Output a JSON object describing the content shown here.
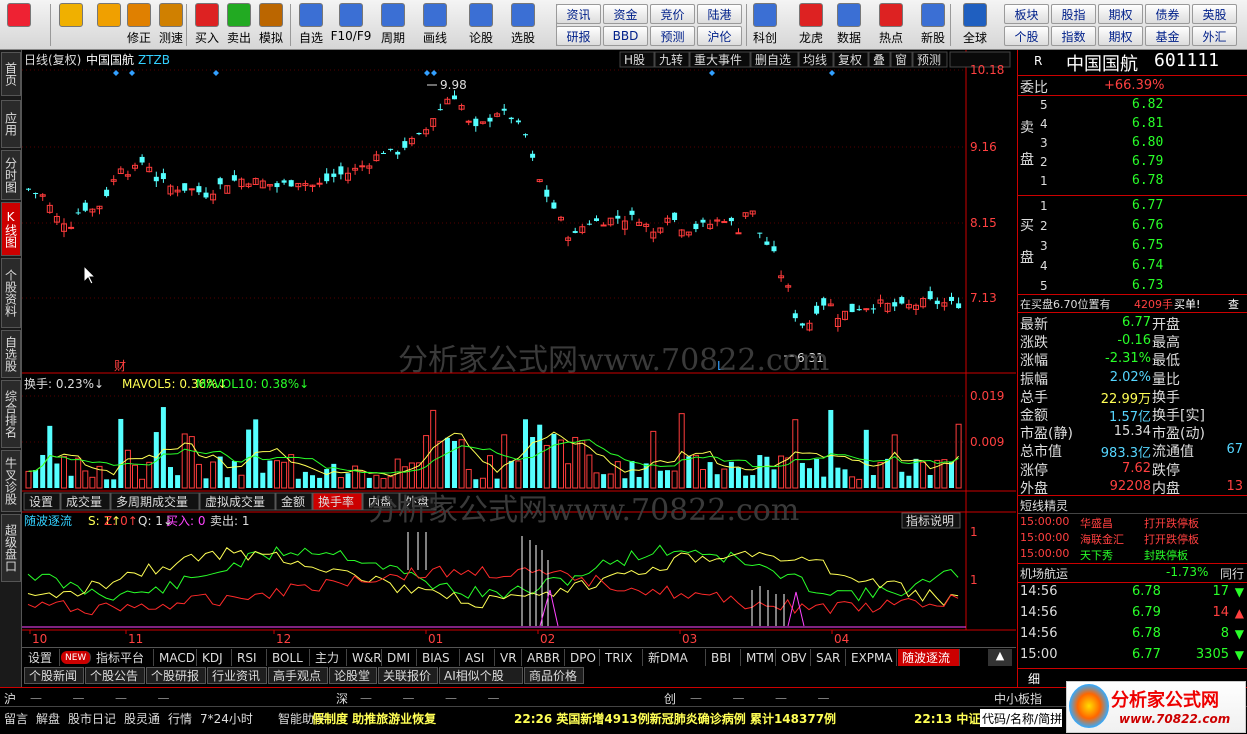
{
  "toolbar": {
    "big": [
      {
        "label": "",
        "icon": "windows-logo-icon"
      },
      {
        "label": "",
        "icon": "back-arrow-icon"
      },
      {
        "label": "",
        "icon": "up-down-arrows-icon"
      },
      {
        "label": "修正",
        "icon": "fix-icon"
      },
      {
        "label": "测速",
        "icon": "speedtest-icon"
      },
      {
        "label": "买入",
        "icon": "buy-icon"
      },
      {
        "label": "卖出",
        "icon": "sell-icon"
      },
      {
        "label": "模拟",
        "icon": "simulate-icon"
      },
      {
        "label": "自选",
        "icon": "favorites-icon"
      },
      {
        "label": "F10/F9",
        "icon": "f10-icon"
      },
      {
        "label": "周期",
        "icon": "period-icon"
      },
      {
        "label": "画线",
        "icon": "draw-icon"
      },
      {
        "label": "论股",
        "icon": "discuss-icon"
      },
      {
        "label": "选股",
        "icon": "stock-pick-icon"
      },
      {
        "label": "科创",
        "icon": "star-market-icon"
      },
      {
        "label": "龙虎",
        "icon": "dragon-tiger-icon"
      },
      {
        "label": "数据",
        "icon": "data-icon"
      },
      {
        "label": "热点",
        "icon": "hotspot-icon"
      },
      {
        "label": "新股",
        "icon": "ipo-icon"
      },
      {
        "label": "全球",
        "icon": "globe-icon"
      }
    ],
    "grid1": [
      "资讯",
      "研报",
      "资金",
      "BBD",
      "竞价",
      "预测",
      "陆港",
      "沪伦"
    ],
    "grid2": [
      "板块",
      "个股",
      "股指",
      "指数",
      "期权",
      "期权",
      "债券",
      "基金",
      "英股",
      "外汇"
    ]
  },
  "left_tabs": [
    "首页",
    "应用",
    "分时图",
    "K线图",
    "个股资料",
    "自选股",
    "综合排名",
    "牛叉诊股",
    "超级盘口"
  ],
  "chart": {
    "header_left": "日线(复权)",
    "stock_name": "中国国航",
    "tag": "ZTZB",
    "header_right": [
      "H股",
      "九转",
      "重大事件",
      "删自选",
      "均线",
      "复权",
      "叠",
      "窗",
      "预测"
    ],
    "price_ticks": [
      "10.18",
      "9.16",
      "8.15",
      "7.13"
    ],
    "high_label": "9.98",
    "low_label": "6.31",
    "cai_label": "财",
    "l_label": "L",
    "vol_legend": {
      "a": "换手: 0.23%↓",
      "b": "MAVOL5: 0.36%↓",
      "c": "MAVOL10: 0.38%↓"
    },
    "vol_ticks": [
      "0.019",
      "0.009"
    ],
    "vol_tabs": [
      "设置",
      "成交量",
      "多周期成交量",
      "虚拟成交量",
      "金额",
      "换手率",
      "内盘",
      "外盘"
    ],
    "ind_legend": {
      "name": "随波逐流",
      "s": "S: 1↑",
      "z": "Z: 0↑",
      "q": "Q: 1↓",
      "buy": "买入: 0",
      "sell": "卖出: 1"
    },
    "ind_btn": "指标说明",
    "ind_ticks": [
      "1",
      "1"
    ],
    "x_labels": [
      "10",
      "11",
      "12",
      "01",
      "02",
      "03",
      "04"
    ]
  },
  "watermark": "分析家公式网www.70822.com",
  "right": {
    "r": "R",
    "name": "中国国航",
    "code": "601111",
    "weibi_label": "委比",
    "weibi_val": "+66.39%",
    "sell_label": "卖盘",
    "buy_label": "买盘",
    "sells": [
      {
        "n": "5",
        "p": "6.82"
      },
      {
        "n": "4",
        "p": "6.81"
      },
      {
        "n": "3",
        "p": "6.80"
      },
      {
        "n": "2",
        "p": "6.79"
      },
      {
        "n": "1",
        "p": "6.78"
      }
    ],
    "buys": [
      {
        "n": "1",
        "p": "6.77"
      },
      {
        "n": "2",
        "p": "6.76"
      },
      {
        "n": "3",
        "p": "6.75"
      },
      {
        "n": "4",
        "p": "6.74"
      },
      {
        "n": "5",
        "p": "6.73"
      }
    ],
    "queue": {
      "text": "在买盘6.70位置有",
      "amount": "4209手",
      "action": "买单!",
      "btn": "查"
    },
    "stats": [
      {
        "l": "最新",
        "v": "6.77",
        "l2": "开盘",
        "c": "#29ff29"
      },
      {
        "l": "涨跌",
        "v": "-0.16",
        "l2": "最高",
        "c": "#29ff29"
      },
      {
        "l": "涨幅",
        "v": "-2.31%",
        "l2": "最低",
        "c": "#29ff29"
      },
      {
        "l": "振幅",
        "v": "2.02%",
        "l2": "量比",
        "c": "#56d6ff"
      },
      {
        "l": "总手",
        "v": "22.99万",
        "l2": "换手",
        "c": "#ffff55"
      },
      {
        "l": "金额",
        "v": "1.57亿",
        "l2": "换手[实]",
        "c": "#56d6ff"
      },
      {
        "l": "市盈(静)",
        "v": "15.34",
        "l2": "市盈(动)",
        "c": "#dddddd"
      },
      {
        "l": "总市值",
        "v": "983.3亿",
        "l2": "流通值",
        "c": "#56d6ff",
        "v2": "67"
      },
      {
        "l": "涨停",
        "v": "7.62",
        "l2": "跌停",
        "c": "#ff4040"
      },
      {
        "l": "外盘",
        "v": "92208",
        "l2": "内盘",
        "c": "#ff4040",
        "v2": "13"
      }
    ],
    "news_title": "短线精灵",
    "news": [
      {
        "t": "15:00:00",
        "n": "华盛昌",
        "e": "打开跌停板"
      },
      {
        "t": "15:00:00",
        "n": "海联金汇",
        "e": "打开跌停板"
      },
      {
        "t": "15:00:00",
        "n": "天下秀",
        "e": "封跌停板"
      }
    ],
    "sector": {
      "n": "机场航运",
      "v": "-1.73%",
      "r": "同行"
    },
    "ticks": [
      {
        "t": "14:56",
        "p": "6.78",
        "v": "17",
        "d": "down"
      },
      {
        "t": "14:56",
        "p": "6.79",
        "v": "14",
        "d": "up"
      },
      {
        "t": "14:56",
        "p": "6.78",
        "v": "8",
        "d": "down"
      },
      {
        "t": "15:00",
        "p": "6.77",
        "v": "3305",
        "d": "down"
      }
    ],
    "bottom_tab": "细"
  },
  "bottom1": [
    "设置",
    "NEW",
    "指标平台",
    "MACD",
    "KDJ",
    "RSI",
    "BOLL",
    "主力",
    "W&R",
    "DMI",
    "BIAS",
    "ASI",
    "VR",
    "ARBR",
    "DPO",
    "TRIX",
    "新DMA",
    "BBI",
    "MTM",
    "OBV",
    "SAR",
    "EXPMA",
    "随波逐流"
  ],
  "bottom2": [
    "个股新闻",
    "个股公告",
    "个股研报",
    "行业资讯",
    "高手观点",
    "论股堂",
    "关联报价",
    "AI相似个股",
    "商品价格"
  ],
  "idx": {
    "a": "沪",
    "b": "深",
    "c": "创",
    "d": "中小板指"
  },
  "status": {
    "items": [
      "留言",
      "解盘",
      "股市日记",
      "股灵通",
      "行情",
      "7*24小时",
      "智能助手"
    ],
    "scroll1": "假制度 助推旅游业恢复",
    "scroll2": "22:26 英国新增4913例新冠肺炎确诊病例 累计148377例",
    "time": "22:13 中证",
    "search": "代码/名称/简拼",
    "logo_text": "分析家公式网",
    "logo_url": "www.70822.com"
  }
}
